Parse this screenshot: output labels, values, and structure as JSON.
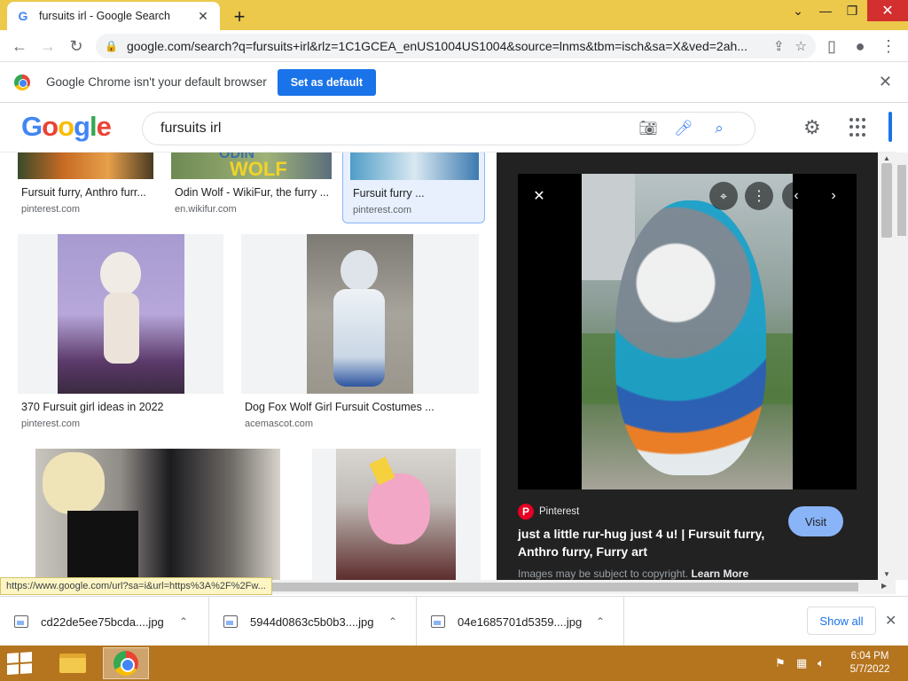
{
  "browser": {
    "tab_title": "fursuits irl - Google Search",
    "tab_favicon": "G",
    "new_tab": "+",
    "url": "google.com/search?q=fursuits+irl&rlz=1C1GCEA_enUS1004US1004&source=lnms&tbm=isch&sa=X&ved=2ah...",
    "window_controls": {
      "dropdown": "⌄",
      "minimize": "—",
      "maximize": "❐",
      "close": "✕"
    }
  },
  "infobar": {
    "message": "Google Chrome isn't your default browser",
    "button": "Set as default",
    "close": "✕"
  },
  "google": {
    "query": "fursuits irl"
  },
  "results": [
    {
      "title": "Fursuit furry, Anthro furr...",
      "source": "pinterest.com"
    },
    {
      "title": "Odin Wolf - WikiFur, the furry ...",
      "source": "en.wikifur.com"
    },
    {
      "title": "Fursuit furry ...",
      "source": "pinterest.com"
    },
    {
      "title": "370 Fursuit girl ideas in 2022",
      "source": "pinterest.com"
    },
    {
      "title": "Dog Fox Wolf Girl Fursuit Costumes ...",
      "source": "acemascot.com"
    }
  ],
  "thumb_texts": {
    "odin": "ODIN",
    "wolf": "WOLF"
  },
  "preview": {
    "source_name": "Pinterest",
    "title": "just a little rur-hug just 4 u! | Fursuit furry, Anthro furry, Furry art",
    "visit": "Visit",
    "copyright": "Images may be subject to copyright.",
    "learn_more": "Learn More"
  },
  "status_url": "https://www.google.com/url?sa=i&url=https%3A%2F%2Fw...",
  "downloads": [
    {
      "file": "cd22de5ee75bcda....jpg"
    },
    {
      "file": "5944d0863c5b0b3....jpg"
    },
    {
      "file": "04e1685701d5359....jpg"
    }
  ],
  "show_all": "Show all",
  "clock": {
    "time": "6:04 PM",
    "date": "5/7/2022"
  },
  "colors": {
    "titlebar": "#ecc84b",
    "taskbar": "#b5741e",
    "accent": "#1a73e8",
    "preview_bg": "#222222"
  }
}
